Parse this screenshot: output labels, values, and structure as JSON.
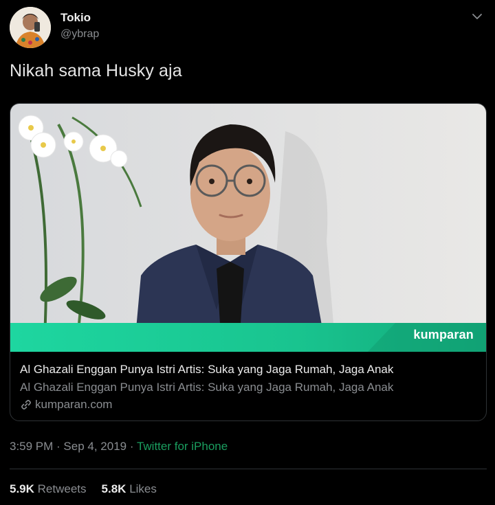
{
  "user": {
    "name": "Tokio",
    "handle": "@ybrap"
  },
  "tweet": {
    "text": "Nikah sama Husky aja"
  },
  "card": {
    "brand_text": "kumparan",
    "title": "Al Ghazali Enggan Punya Istri Artis: Suka yang Jaga Rumah, Jaga Anak",
    "description": "Al Ghazali Enggan Punya Istri Artis: Suka yang Jaga Rumah, Jaga Anak",
    "domain": "kumparan.com"
  },
  "meta": {
    "time": "3:59 PM",
    "sep1": " · ",
    "date": "Sep 4, 2019",
    "sep2": " · ",
    "source": "Twitter for iPhone"
  },
  "stats": {
    "retweets_count": "5.9K",
    "retweets_label": "Retweets",
    "likes_count": "5.8K",
    "likes_label": "Likes"
  },
  "colors": {
    "background": "#000000",
    "source_link": "#1a9e5f",
    "brand_band": "#1fcf98"
  },
  "icons": {
    "caret": "chevron-down-icon",
    "link": "link-icon"
  }
}
